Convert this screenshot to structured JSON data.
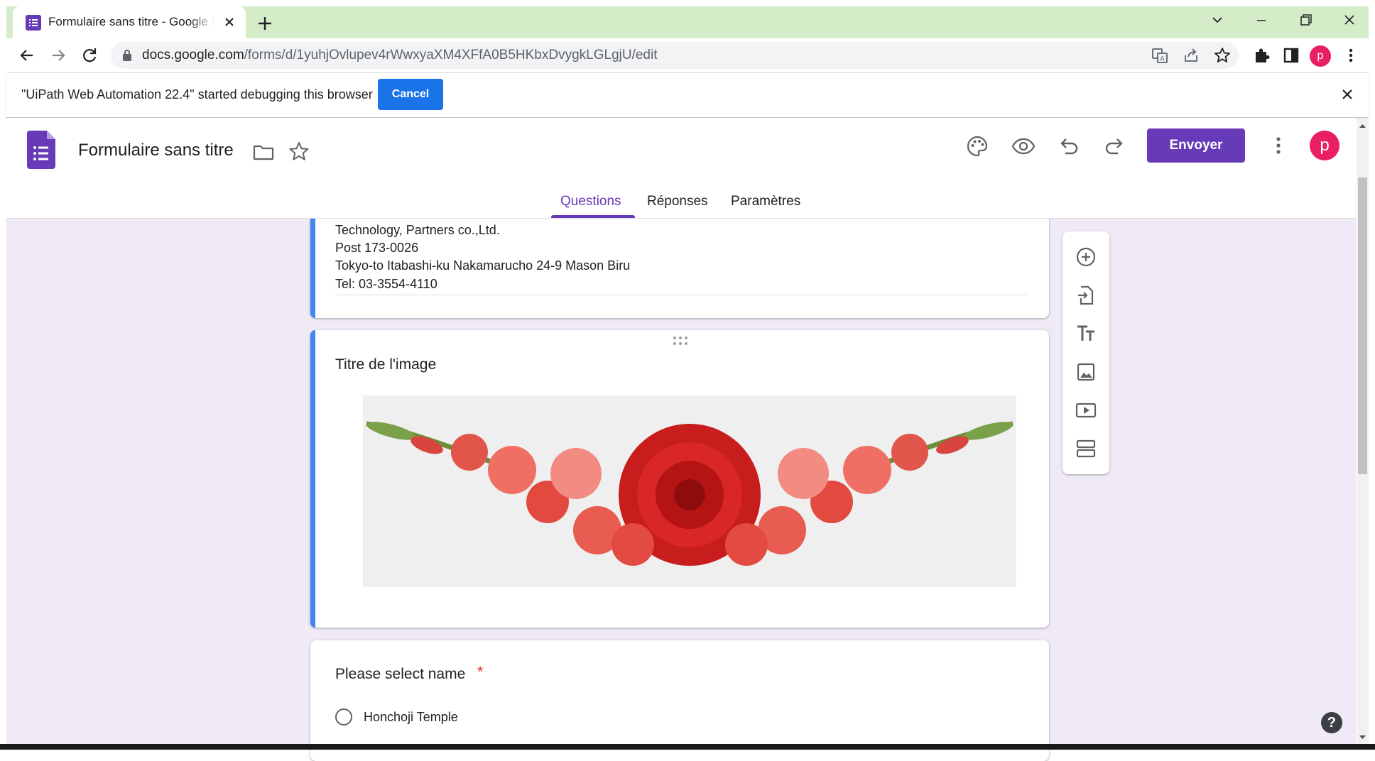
{
  "browser": {
    "tab_title": "Formulaire sans titre - Google Forms",
    "url_host": "docs.google.com",
    "url_path": "/forms/d/1yuhjOvlupev4rWwxyaXM4XFfA0B5HKbxDvygkLGLgjU/edit",
    "profile_initial": "p",
    "tab_strip_color": "#d5ecc8"
  },
  "infobar": {
    "message": "\"UiPath Web Automation 22.4\" started debugging this browser",
    "cancel_label": "Cancel"
  },
  "form_header": {
    "title": "Formulaire sans titre",
    "send_label": "Envoyer",
    "avatar_initial": "p",
    "accent_color": "#673ab7",
    "tabs": [
      {
        "label": "Questions",
        "active": true
      },
      {
        "label": "Réponses",
        "active": false
      },
      {
        "label": "Paramètres",
        "active": false
      }
    ]
  },
  "cards": {
    "address_lines": [
      "Technology, Partners co.,Ltd.",
      "Post 173-0026",
      "Tokyo-to Itabashi-ku Nakamarucho 24-9 Mason Biru",
      "Tel: 03-3554-4110"
    ],
    "image_title": "Titre de l'image",
    "question_title": "Please select name",
    "required_marker": "*",
    "options": [
      "Honchoji Temple"
    ]
  },
  "side_toolbar": {
    "icons": [
      "add-question-icon",
      "import-questions-icon",
      "add-title-icon",
      "add-image-icon",
      "add-video-icon",
      "add-section-icon"
    ]
  },
  "help": {
    "label": "?"
  }
}
